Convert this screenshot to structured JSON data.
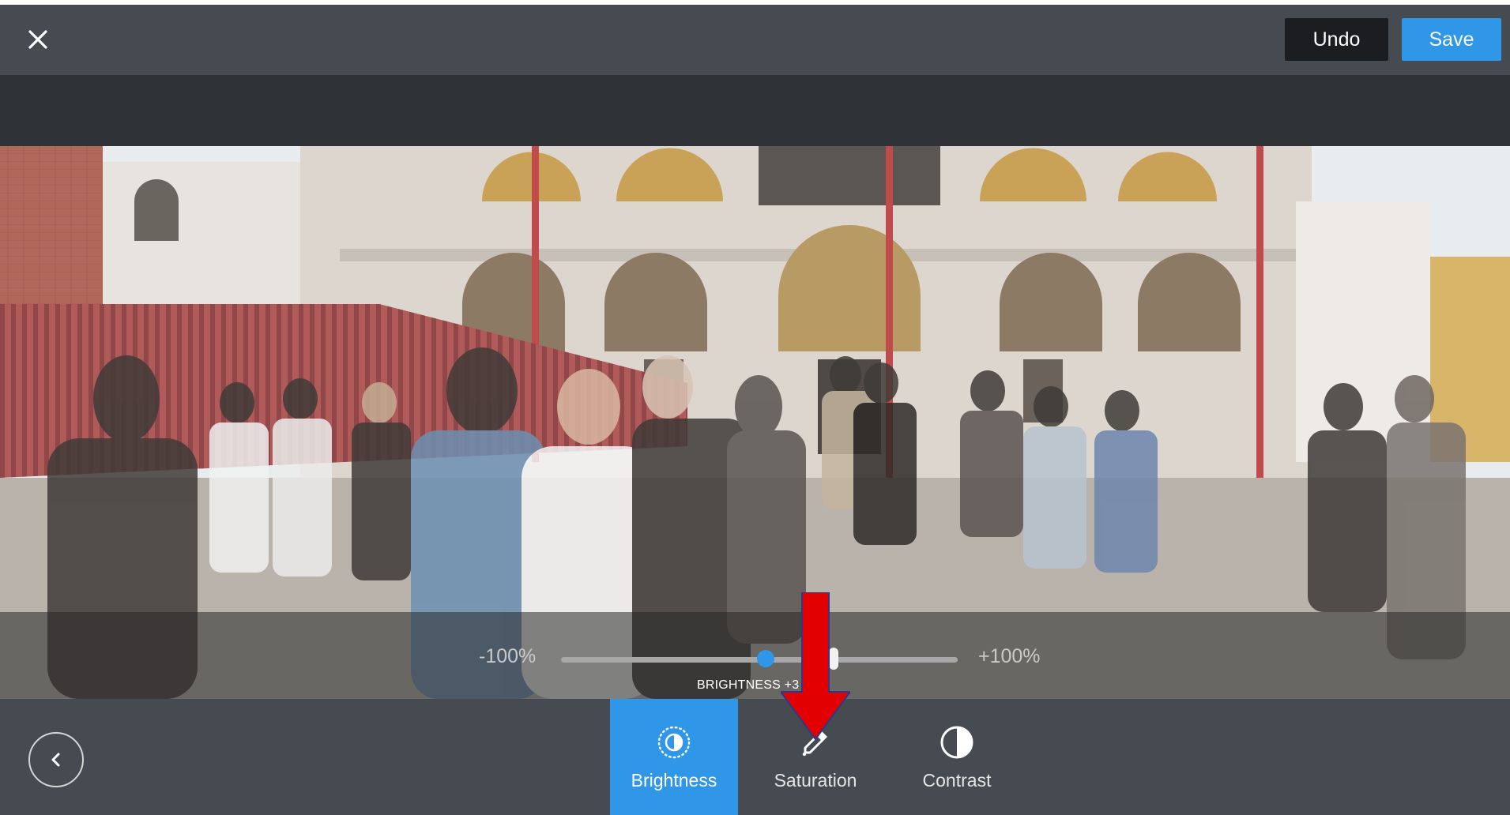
{
  "toolbar": {
    "undo_label": "Undo",
    "save_label": "Save",
    "close_icon": "close-icon"
  },
  "adjustment": {
    "min_label": "-100%",
    "max_label": "+100%",
    "value_label": "BRIGHTNESS +3",
    "value": 3,
    "range": [
      -100,
      100
    ]
  },
  "tools": [
    {
      "label": "Brightness",
      "icon": "brightness-icon",
      "active": true
    },
    {
      "label": "Saturation",
      "icon": "eyedropper-icon",
      "active": false
    },
    {
      "label": "Contrast",
      "icon": "contrast-icon",
      "active": false
    }
  ],
  "colors": {
    "accent": "#2f96e8",
    "toolbar_bg": "#464b51",
    "annotation_arrow": "#e30000"
  }
}
